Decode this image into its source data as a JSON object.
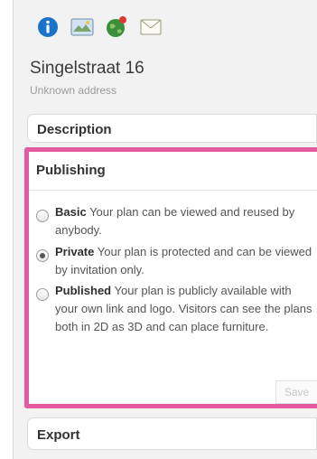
{
  "toolbar": {
    "icons": [
      "info-icon",
      "map-image-icon",
      "globe-pin-icon",
      "envelope-icon"
    ]
  },
  "address": {
    "title": "Singelstraat 16",
    "subtitle": "Unknown address"
  },
  "sections": {
    "description": "Description",
    "publishing": "Publishing",
    "export": "Export"
  },
  "publishing_options": [
    {
      "label": "Basic",
      "text": " Your plan can be viewed and reused by anybody.",
      "checked": false
    },
    {
      "label": "Private",
      "text": " Your plan is protected and can be viewed by invitation only.",
      "checked": true
    },
    {
      "label": "Published",
      "text": " Your plan is publicly available with your own link and logo. Visitors can see the plans both in 2D as 3D and can place furniture.",
      "checked": false
    }
  ],
  "save_label": "Save",
  "colors": {
    "highlight": "#e45aa1",
    "info_blue": "#1a73c8"
  }
}
